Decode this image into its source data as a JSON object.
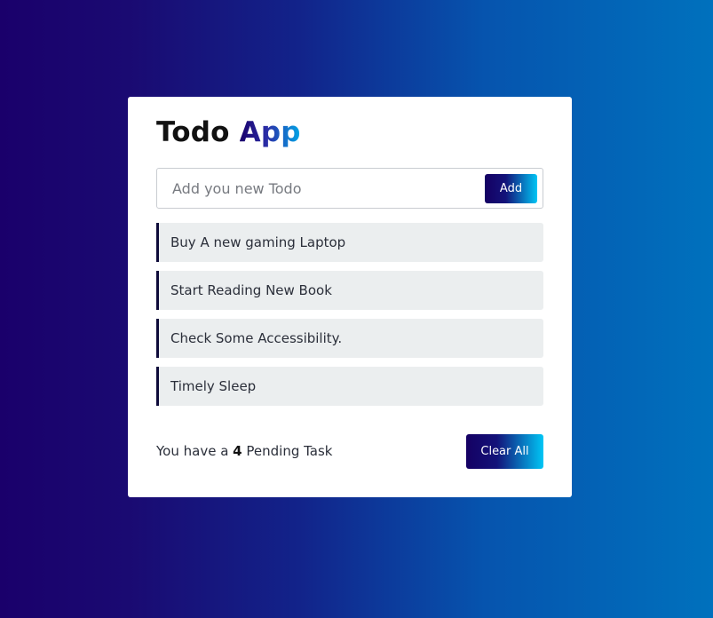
{
  "app": {
    "title_main": "Todo",
    "title_accent": "App"
  },
  "input": {
    "placeholder": "Add you new Todo",
    "value": "",
    "add_label": "Add"
  },
  "todos": [
    {
      "text": "Buy A new gaming Laptop"
    },
    {
      "text": "Start Reading New Book"
    },
    {
      "text": "Check Some Accessibility."
    },
    {
      "text": "Timely Sleep"
    }
  ],
  "footer": {
    "pending_prefix": "You have a",
    "pending_count": "4",
    "pending_suffix": "Pending Task",
    "clear_label": "Clear All"
  },
  "colors": {
    "background_start": "#1a006b",
    "background_end": "#0071bd",
    "accent_dark": "#150063",
    "accent_light": "#00c6f5",
    "item_background": "#ebeeef",
    "item_border": "#0e0b3a"
  }
}
